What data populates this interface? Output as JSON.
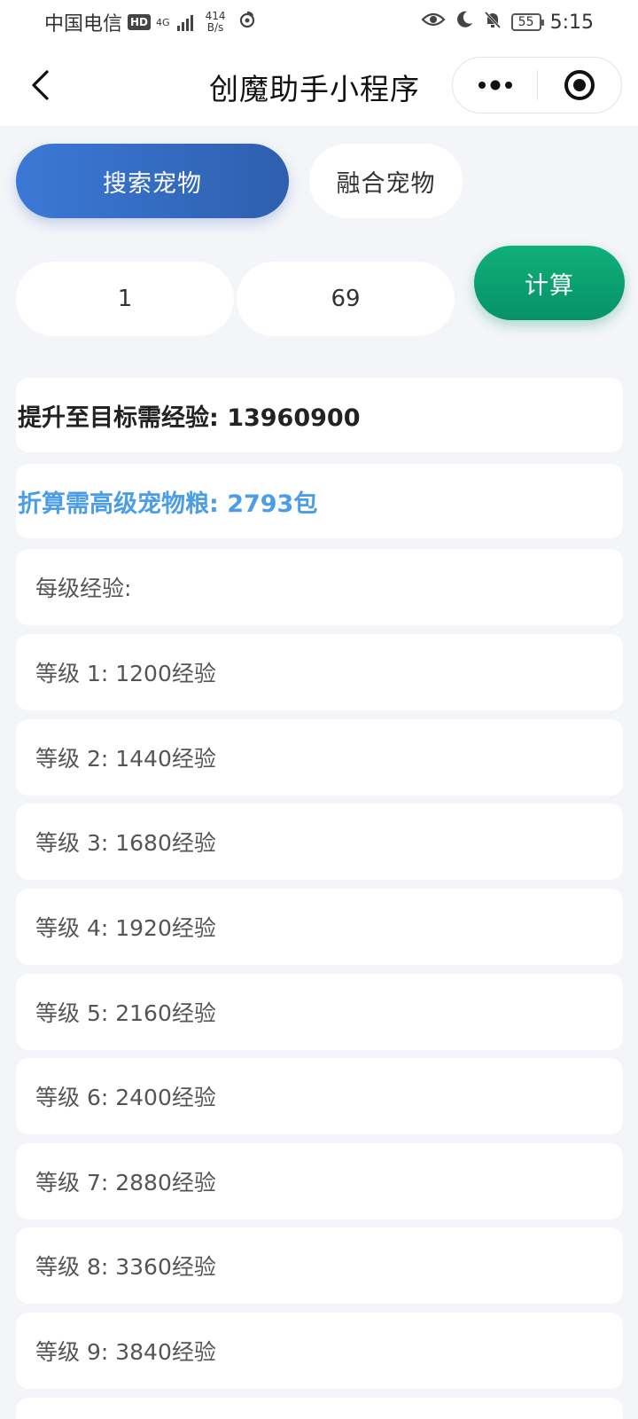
{
  "status_bar": {
    "carrier": "中国电信",
    "hd": "HD",
    "network": "4G",
    "speed_value": "414",
    "speed_unit": "B/s",
    "battery": "55",
    "time": "5:15"
  },
  "nav": {
    "title": "创魔助手小程序"
  },
  "tabs": [
    {
      "label": "搜索宠物",
      "active": true
    },
    {
      "label": "融合宠物",
      "active": false
    }
  ],
  "inputs": {
    "start_level": "1",
    "target_level": "69"
  },
  "calc_button": {
    "label": "计算"
  },
  "results": {
    "total_exp": "提升至目标需经验: 13960900",
    "food_needed": "折算需高级宠物粮: 2793包",
    "per_level_header": "每级经验:"
  },
  "levels": [
    "等级 1: 1200经验",
    "等级 2: 1440经验",
    "等级 3: 1680经验",
    "等级 4: 1920经验",
    "等级 5: 2160经验",
    "等级 6: 2400经验",
    "等级 7: 2880经验",
    "等级 8: 3360经验",
    "等级 9: 3840经验"
  ],
  "colors": {
    "tab_active": "#3b79d6",
    "calc_button": "#079266",
    "food_text": "#4a9de6",
    "background": "#f4f5f9"
  }
}
